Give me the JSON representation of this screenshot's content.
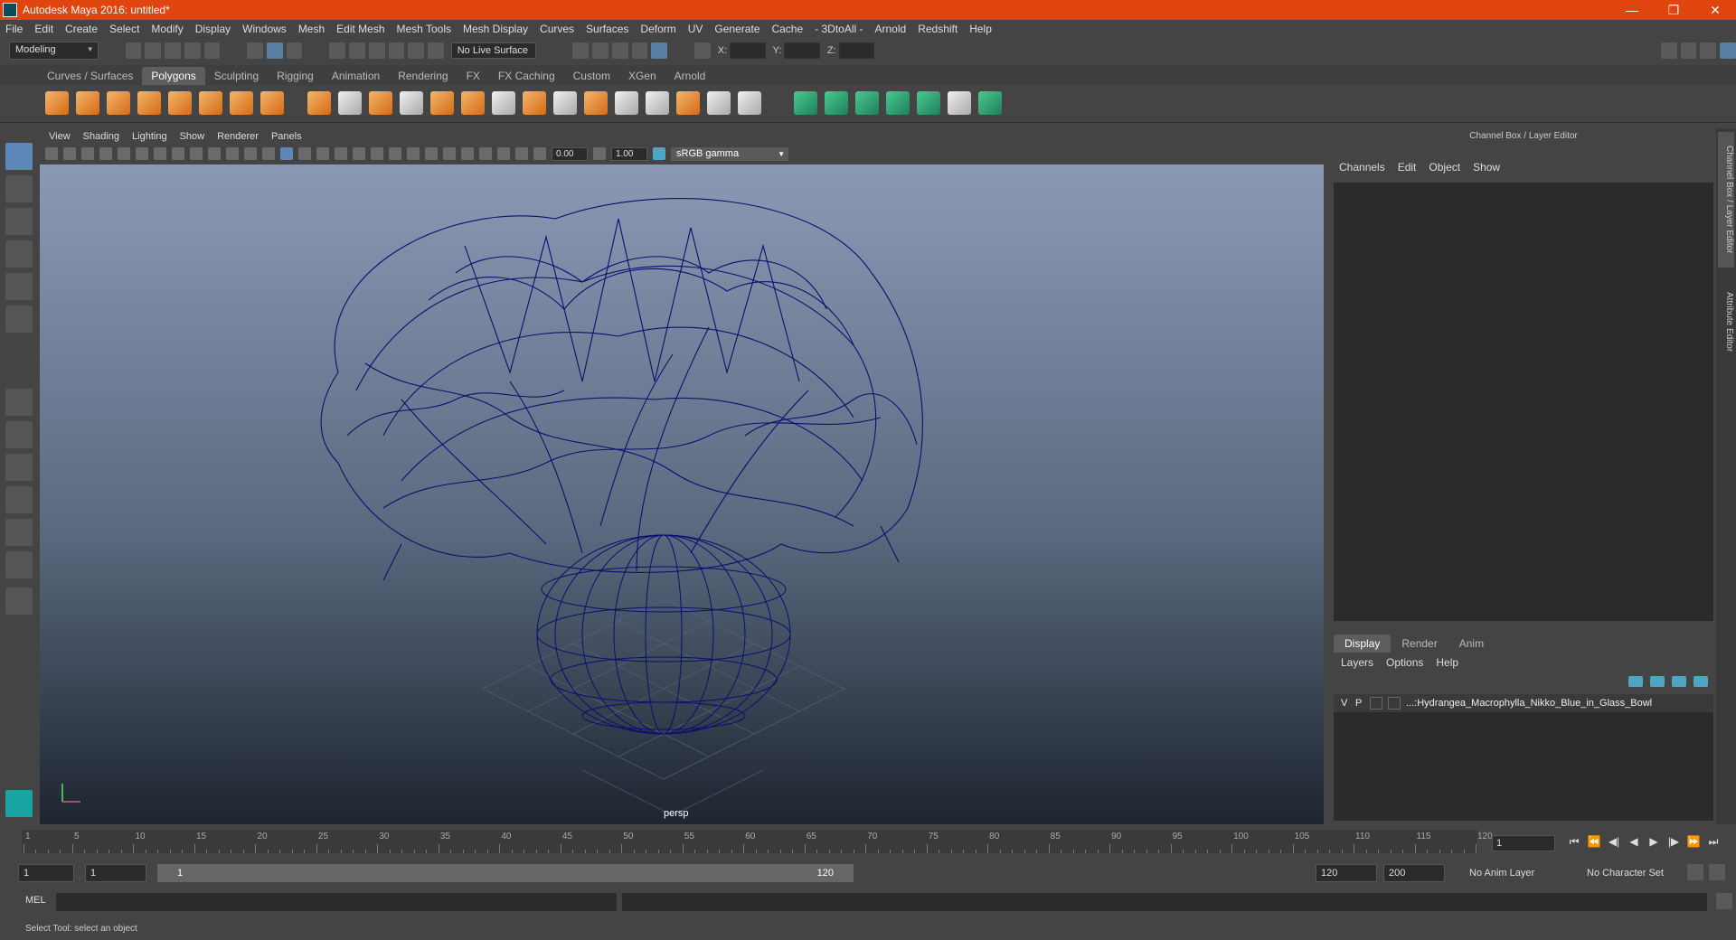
{
  "window": {
    "title": "Autodesk Maya 2016: untitled*",
    "controls": [
      "—",
      "❐",
      "✕"
    ]
  },
  "menubar": [
    "File",
    "Edit",
    "Create",
    "Select",
    "Modify",
    "Display",
    "Windows",
    "Mesh",
    "Edit Mesh",
    "Mesh Tools",
    "Mesh Display",
    "Curves",
    "Surfaces",
    "Deform",
    "UV",
    "Generate",
    "Cache",
    "- 3DtoAll -",
    "Arnold",
    "Redshift",
    "Help"
  ],
  "statusline": {
    "mode": "Modeling",
    "live_surface": "No Live Surface",
    "x_label": "X:",
    "y_label": "Y:",
    "z_label": "Z:"
  },
  "shelf_tabs": [
    "Curves / Surfaces",
    "Polygons",
    "Sculpting",
    "Rigging",
    "Animation",
    "Rendering",
    "FX",
    "FX Caching",
    "Custom",
    "XGen",
    "Arnold"
  ],
  "active_shelf": "Polygons",
  "viewport": {
    "menu": [
      "View",
      "Shading",
      "Lighting",
      "Show",
      "Renderer",
      "Panels"
    ],
    "exposure": "0.00",
    "gamma_value": "1.00",
    "color_space": "sRGB gamma",
    "camera": "persp"
  },
  "channel_box": {
    "title": "Channel Box / Layer Editor",
    "menu": [
      "Channels",
      "Edit",
      "Object",
      "Show"
    ],
    "layer_tabs": [
      "Display",
      "Render",
      "Anim"
    ],
    "layer_menu": [
      "Layers",
      "Options",
      "Help"
    ],
    "layer": {
      "v": "V",
      "p": "P",
      "name": "...:Hydrangea_Macrophylla_Nikko_Blue_in_Glass_Bowl"
    }
  },
  "side_tabs": [
    "Channel Box / Layer Editor",
    "Attribute Editor"
  ],
  "timeline": {
    "ticks": [
      "1",
      "5",
      "10",
      "15",
      "20",
      "25",
      "30",
      "35",
      "40",
      "45",
      "50",
      "55",
      "60",
      "65",
      "70",
      "75",
      "80",
      "85",
      "90",
      "95",
      "100",
      "105",
      "110",
      "115",
      "120"
    ],
    "current_frame": "1",
    "controls": [
      "⏮",
      "⏪",
      "◀|",
      "◀",
      "▶",
      "|▶",
      "⏩",
      "⏭"
    ]
  },
  "range": {
    "start": "1",
    "playback_start": "1",
    "slider_start": "1",
    "slider_end": "120",
    "playback_end": "120",
    "end": "200",
    "anim_layer": "No Anim Layer",
    "character_set": "No Character Set"
  },
  "command": {
    "label": "MEL"
  },
  "help_line": "Select Tool: select an object",
  "colors": {
    "titlebar": "#e0450f",
    "wireframe": "#0b0f6e",
    "accent": "#5d87b8"
  }
}
